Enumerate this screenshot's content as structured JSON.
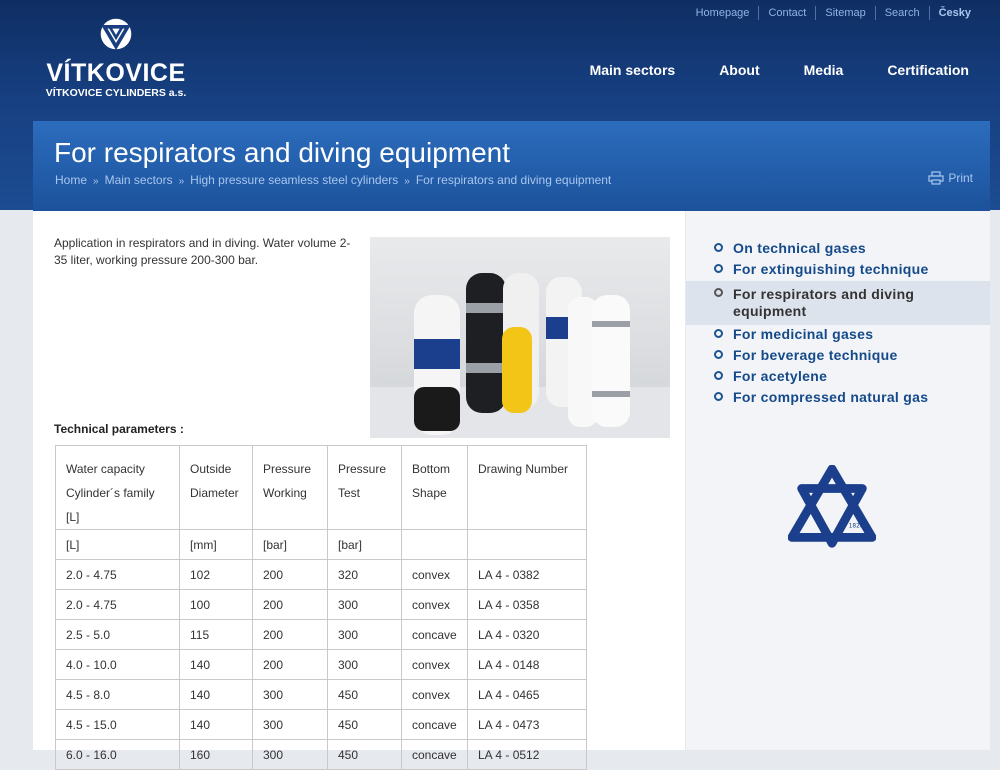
{
  "brand": {
    "name": "VÍTKOVICE",
    "subtitle": "VÍTKOVICE CYLINDERS a.s."
  },
  "top_links": [
    "Homepage",
    "Contact",
    "Sitemap",
    "Search",
    "Česky"
  ],
  "main_nav": [
    "Main sectors",
    "About",
    "Media",
    "Certification"
  ],
  "page": {
    "title": "For respirators and diving equipment",
    "breadcrumb": [
      "Home",
      "Main sectors",
      "High pressure seamless steel cylinders",
      "For respirators and diving equipment"
    ],
    "print_label": "Print",
    "intro": "Application in respirators and in diving. Water volume 2-35 liter, working pressure 200-300 bar.",
    "tech_label": "Technical parameters :"
  },
  "table": {
    "headers": [
      [
        "Water capacity",
        "Cylinder´s family [L]"
      ],
      [
        "Outside",
        "Diameter"
      ],
      [
        "Pressure",
        "Working"
      ],
      [
        "Pressure",
        "Test"
      ],
      [
        "Bottom",
        "Shape"
      ],
      [
        "Drawing Number",
        ""
      ]
    ],
    "units": [
      "[L]",
      "[mm]",
      "[bar]",
      "[bar]",
      "",
      ""
    ],
    "rows": [
      [
        "2.0 - 4.75",
        "102",
        "200",
        "320",
        "convex",
        "LA 4 - 0382"
      ],
      [
        "2.0 - 4.75",
        "100",
        "200",
        "300",
        "convex",
        "LA 4 - 0358"
      ],
      [
        "2.5 - 5.0",
        "115",
        "200",
        "300",
        "concave",
        "LA 4 - 0320"
      ],
      [
        "4.0 - 10.0",
        "140",
        "200",
        "300",
        "convex",
        "LA 4 - 0148"
      ],
      [
        "4.5 - 8.0",
        "140",
        "300",
        "450",
        "convex",
        "LA 4 - 0465"
      ],
      [
        "4.5 - 15.0",
        "140",
        "300",
        "450",
        "concave",
        "LA 4 - 0473"
      ],
      [
        "6.0 - 16.0",
        "160",
        "300",
        "450",
        "concave",
        "LA 4 - 0512"
      ]
    ]
  },
  "sidebar": {
    "items": [
      {
        "label": "On technical gases",
        "active": false
      },
      {
        "label": "For extinguishing technique",
        "active": false
      },
      {
        "label": "For respirators and diving equipment",
        "active": true
      },
      {
        "label": "For medicinal gases",
        "active": false
      },
      {
        "label": "For beverage technique",
        "active": false
      },
      {
        "label": "For acetylene",
        "active": false
      },
      {
        "label": "For compressed natural gas",
        "active": false
      }
    ],
    "logo_year": "1828"
  },
  "colors": {
    "header_dark": "#0f2e63",
    "banner": "#2562b0",
    "link": "#154a8a"
  }
}
